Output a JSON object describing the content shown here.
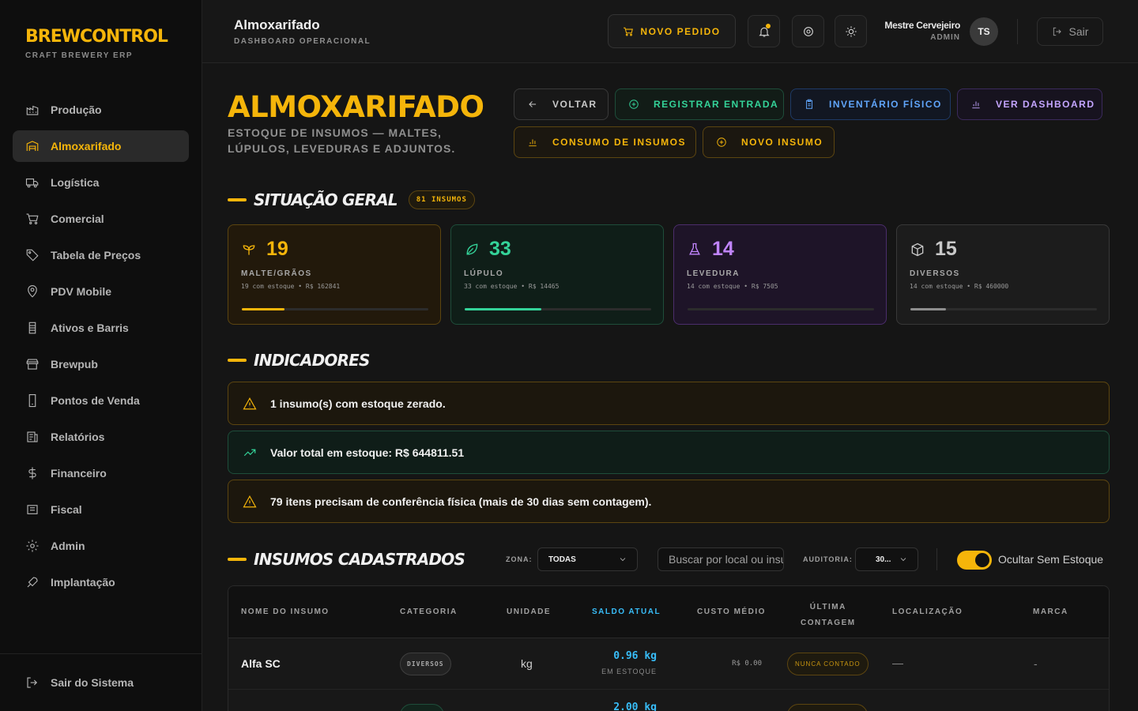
{
  "brand": {
    "name": "BREWCONTROL",
    "tagline": "CRAFT BREWERY ERP"
  },
  "sidebar": {
    "items": [
      {
        "label": "Produção",
        "icon": "factory-icon"
      },
      {
        "label": "Almoxarifado",
        "icon": "warehouse-icon",
        "active": true
      },
      {
        "label": "Logística",
        "icon": "truck-icon"
      },
      {
        "label": "Comercial",
        "icon": "cart-icon"
      },
      {
        "label": "Tabela de Preços",
        "icon": "tag-icon"
      },
      {
        "label": "PDV Mobile",
        "icon": "map-pin-icon"
      },
      {
        "label": "Ativos e Barris",
        "icon": "barrel-icon"
      },
      {
        "label": "Brewpub",
        "icon": "store-icon"
      },
      {
        "label": "Pontos de Venda",
        "icon": "smartphone-icon"
      },
      {
        "label": "Relatórios",
        "icon": "report-icon"
      },
      {
        "label": "Financeiro",
        "icon": "dollar-icon"
      },
      {
        "label": "Fiscal",
        "icon": "receipt-icon"
      },
      {
        "label": "Admin",
        "icon": "gear-icon"
      },
      {
        "label": "Implantação",
        "icon": "rocket-icon"
      }
    ],
    "logout_label": "Sair do Sistema"
  },
  "topbar": {
    "title": "Almoxarifado",
    "subtitle": "DASHBOARD OPERACIONAL",
    "new_order_label": "NOVO PEDIDO",
    "user_name": "Mestre Cervejeiro",
    "user_role": "ADMIN",
    "user_initials": "TS",
    "logout_label": "Sair"
  },
  "page": {
    "title": "ALMOXARIFADO",
    "subtitle": "ESTOQUE DE INSUMOS — MALTES, LÚPULOS, LEVEDURAS E ADJUNTOS.",
    "actions": {
      "back": "VOLTAR",
      "register_entry": "REGISTRAR ENTRADA",
      "physical_inventory": "INVENTÁRIO FÍSICO",
      "view_dashboard": "VER DASHBOARD",
      "consumption": "CONSUMO DE INSUMOS",
      "new_supply": "NOVO INSUMO"
    }
  },
  "overview": {
    "title": "SITUAÇÃO GERAL",
    "badge": "81 INSUMOS",
    "cards": [
      {
        "count": "19",
        "label": "MALTE/GRÃOS",
        "meta": "19 com estoque • R$ 162841",
        "fill": 0.23,
        "color": "#f5b50a"
      },
      {
        "count": "33",
        "label": "LÚPULO",
        "meta": "33 com estoque • R$ 14465",
        "fill": 0.41,
        "color": "#34d399"
      },
      {
        "count": "14",
        "label": "LEVEDURA",
        "meta": "14 com estoque • R$ 7505",
        "fill": 0.0,
        "color": "#c084fc"
      },
      {
        "count": "15",
        "label": "DIVERSOS",
        "meta": "14 com estoque • R$ 460000",
        "fill": 0.19,
        "color": "#8e8e8e"
      }
    ]
  },
  "indicators": {
    "title": "INDICADORES",
    "items": [
      "1 insumo(s) com estoque zerado.",
      "Valor total em estoque: R$ 644811.51",
      "79 itens precisam de conferência física (mais de 30 dias sem contagem)."
    ]
  },
  "supplies": {
    "title": "INSUMOS CADASTRADOS",
    "zone_label": "ZONA:",
    "zone_value": "TODAS",
    "search_placeholder": "Buscar por local ou insumo",
    "audit_label": "AUDITORIA:",
    "audit_value": "30...",
    "hide_empty_label": "Ocultar Sem Estoque",
    "hide_empty_on": true,
    "columns": {
      "name": "NOME DO INSUMO",
      "category": "CATEGORIA",
      "unit": "UNIDADE",
      "balance": "SALDO ATUAL",
      "avg_cost": "CUSTO MÉDIO",
      "last_count_1": "ÚLTIMA",
      "last_count_2": "CONTAGEM",
      "location": "LOCALIZAÇÃO",
      "brand": "MARCA"
    },
    "rows": [
      {
        "name": "Alfa SC",
        "category": "DIVERSOS",
        "unit": "kg",
        "balance": "0.96 kg",
        "balance_sub": "EM ESTOQUE",
        "avg_cost": "R$ 0.00",
        "last_count": "NUNCA CONTADO",
        "location": "—",
        "brand": "-"
      },
      {
        "name": "",
        "category": "",
        "unit": "",
        "balance": "2.00 kg",
        "balance_sub": "",
        "avg_cost": "",
        "last_count": "",
        "location": "",
        "brand": ""
      }
    ]
  }
}
